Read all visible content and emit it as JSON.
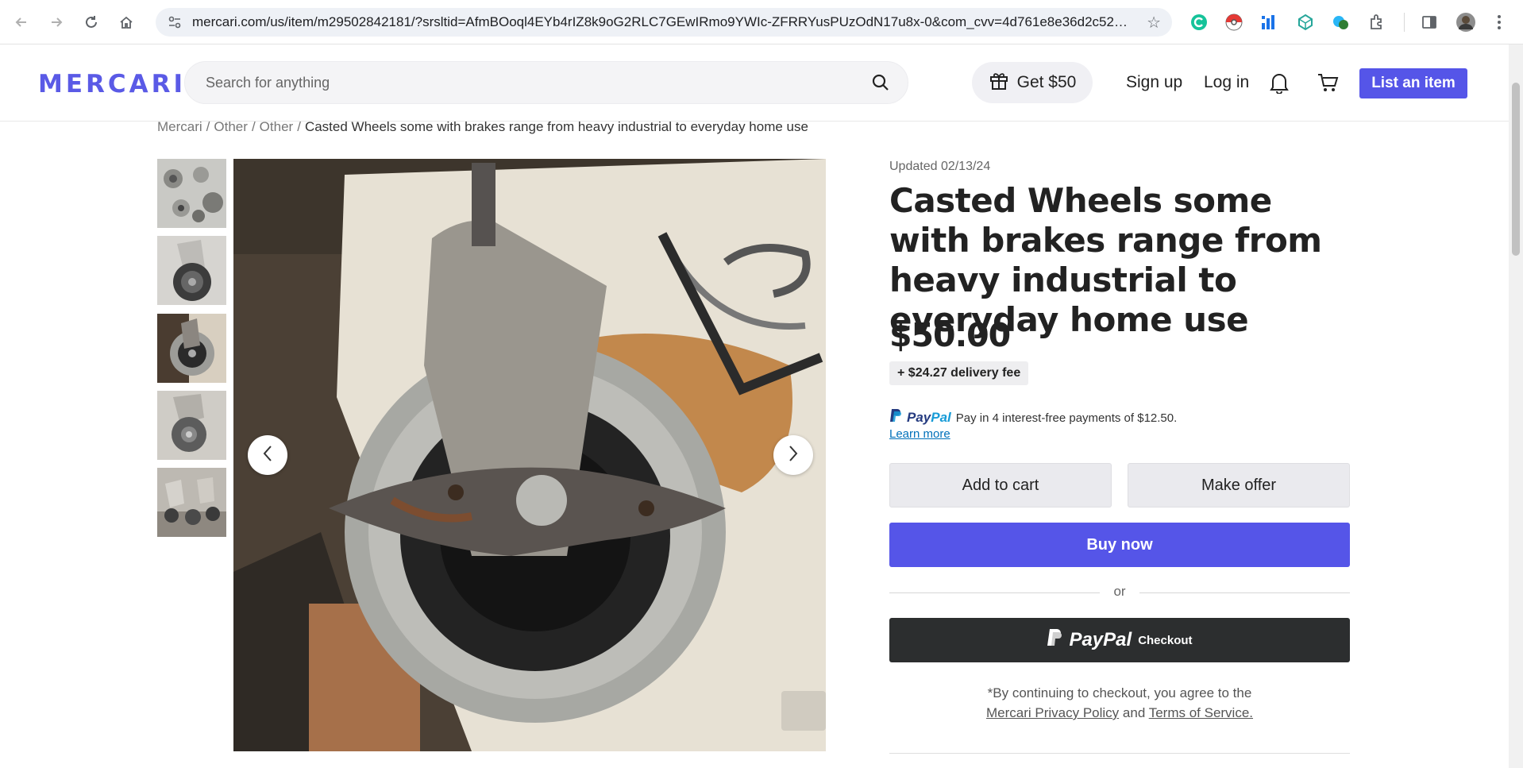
{
  "browser": {
    "url": "mercari.com/us/item/m29502842181/?srsltid=AfmBOoql4EYb4rIZ8k9oG2RLC7GEwIRmo9YWIc-ZFRRYusPUzOdN17u8x-0&com_cvv=4d761e8e36d2c524..."
  },
  "header": {
    "logo": "MERCARI",
    "search_placeholder": "Search for anything",
    "promo_label": "Get $50",
    "signup_label": "Sign up",
    "login_label": "Log in",
    "list_item_label": "List an item",
    "brand_color": "#5555e8"
  },
  "breadcrumb": {
    "items": [
      "Mercari",
      "Other",
      "Other"
    ],
    "separator": "/",
    "current": "Casted Wheels some with brakes range from heavy industrial to everyday home use"
  },
  "listing": {
    "updated": "Updated 02/13/24",
    "title": "Casted Wheels some with brakes range from heavy industrial to everyday home use",
    "price": "$50.00",
    "delivery_fee": "+ $24.27 delivery fee",
    "paypal_logo_pay": "Pay",
    "paypal_logo_pal": "Pal",
    "paypal_message": "Pay in 4 interest-free payments of $12.50.",
    "learn_more": "Learn more",
    "add_to_cart": "Add to cart",
    "make_offer": "Make offer",
    "buy_now": "Buy now",
    "or": "or",
    "paypal_checkout_logo": "PayPal",
    "paypal_checkout_label": "Checkout",
    "terms_prefix": "*By continuing to checkout, you agree to the",
    "privacy_link": "Mercari Privacy Policy",
    "terms_and": "and",
    "terms_link": "Terms of Service."
  },
  "gallery": {
    "thumbnail_count": 5,
    "active_thumbnail": 3
  }
}
